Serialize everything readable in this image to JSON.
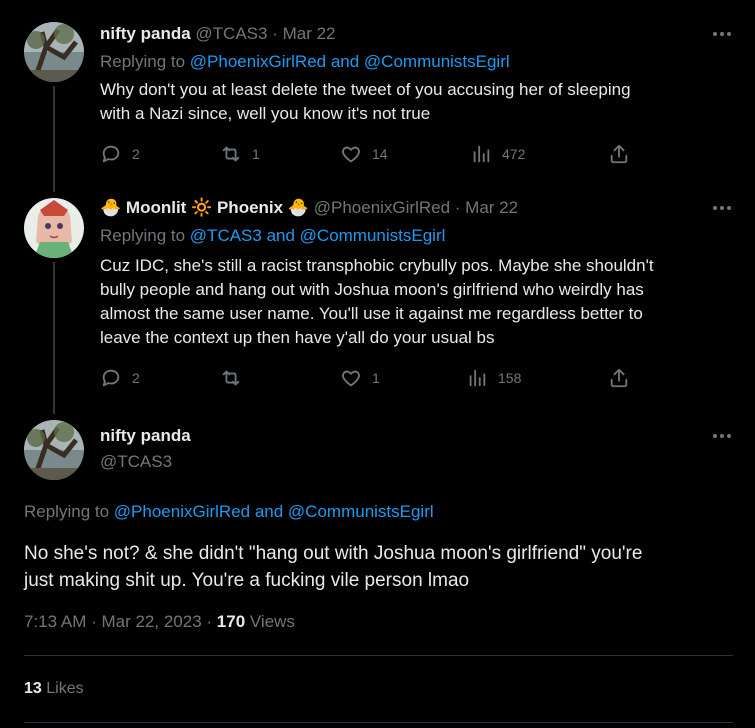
{
  "tweet1": {
    "name": "nifty panda",
    "handle": "@TCAS3",
    "date": "· Mar 22",
    "replying_label": "Replying to",
    "replying_to": "@PhoenixGirlRed and @CommunistsEgirl",
    "text_lines": [
      "Why don't you at least delete the tweet of you accusing her of sleeping",
      "with a Nazi since, well you know it's not true"
    ],
    "replies": "2",
    "retweets": "1",
    "likes": "14",
    "views": "472"
  },
  "tweet2": {
    "name_prefix_emoji": "🐣",
    "name_part1": "Moonlit",
    "name_mid_emoji": "🔆",
    "name_part2": "Phoenix",
    "name_suffix_emoji": "🐣",
    "handle": "@PhoenixGirlRed",
    "date": "· Mar 22",
    "replying_label": "Replying to",
    "replying_to": "@TCAS3 and @CommunistsEgirl",
    "text_lines": [
      "Cuz IDC, she's still a racist transphobic crybully pos. Maybe she shouldn't",
      "bully people and hang out with Joshua moon's girlfriend who weirdly has",
      "almost the same user name. You'll use it against me regardless better to",
      "leave the context up then have y'all do your usual bs"
    ],
    "replies": "2",
    "retweets": "",
    "likes": "1",
    "views": "158"
  },
  "main": {
    "name": "nifty panda",
    "handle": "@TCAS3",
    "replying_label": "Replying to",
    "replying_to": "@PhoenixGirlRed and @CommunistsEgirl",
    "text_lines": [
      "No she's not? & she didn't \"hang out with Joshua moon's girlfriend\" you're",
      "just making shit up. You're a fucking vile person lmao"
    ],
    "timestamp": "7:13 AM · Mar 22, 2023 ·",
    "views_count": "170",
    "views_label": "Views",
    "likes_count": "13",
    "likes_label": "Likes"
  },
  "icons": {
    "reply": "reply-icon",
    "retweet": "retweet-icon",
    "like": "like-icon",
    "views": "views-icon",
    "share": "share-icon",
    "more": "more-icon"
  }
}
